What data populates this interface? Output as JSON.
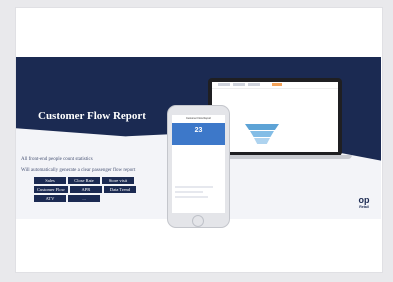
{
  "title": "Customer Flow Report",
  "lines": [
    "All front-end people count statistics",
    "Will automatically generate a clear passenger flow report"
  ],
  "chips": [
    "Sales",
    "Close Rate",
    "Store visit",
    "Customer Flow",
    "APR",
    "Data Trend",
    "ATV",
    "..."
  ],
  "phone": {
    "header": "Customer Flow Report",
    "hero_value": "23"
  },
  "logo": {
    "mark": "op",
    "text": "Retail"
  },
  "colors": {
    "navy": "#1b2a52",
    "accent": "#e8572a",
    "blue": "#3d78c9"
  }
}
